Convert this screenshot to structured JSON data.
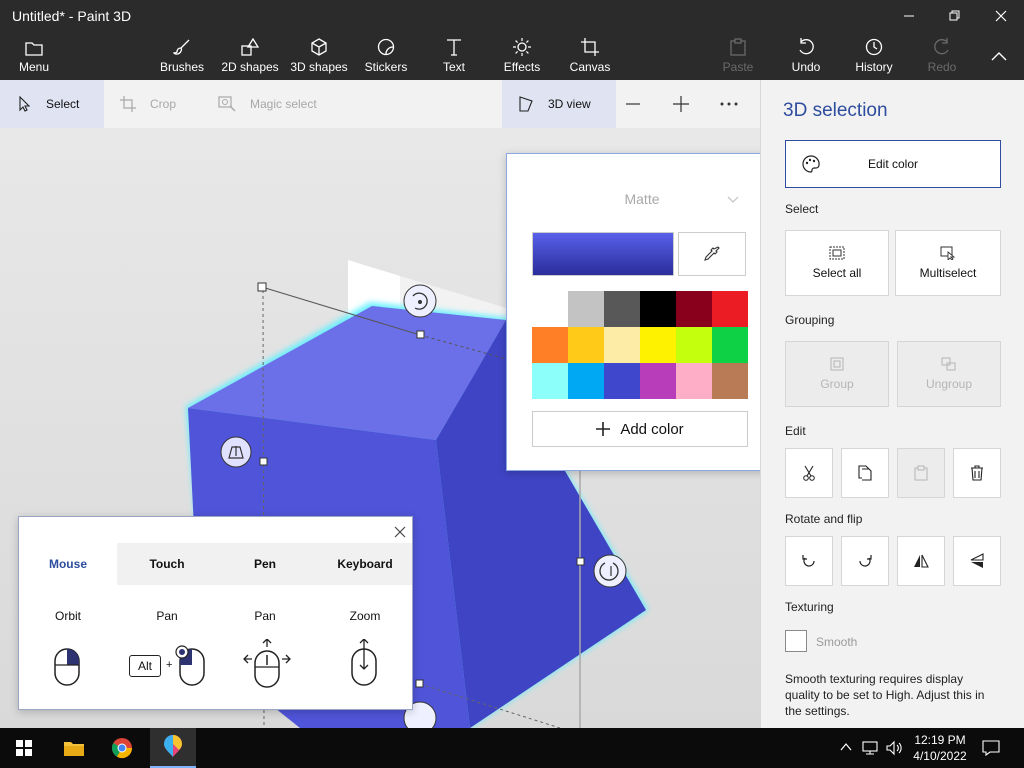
{
  "window": {
    "title": "Untitled* - Paint 3D"
  },
  "ribbon": {
    "menu": "Menu",
    "tools": [
      "Brushes",
      "2D shapes",
      "3D shapes",
      "Stickers",
      "Text",
      "Effects",
      "Canvas"
    ],
    "paste": "Paste",
    "undo": "Undo",
    "history": "History",
    "redo": "Redo"
  },
  "toolbar": {
    "select": "Select",
    "crop": "Crop",
    "magic_select": "Magic select",
    "view_3d": "3D view"
  },
  "color_popup": {
    "finish": "Matte",
    "selected_color": "#3b3fc8",
    "add_color": "Add color",
    "swatches": [
      "#ffffff",
      "#c3c3c3",
      "#585858",
      "#000000",
      "#88001b",
      "#ec1c24",
      "#ff7f27",
      "#ffca18",
      "#fdeca6",
      "#fff200",
      "#c4ff0e",
      "#0ed145",
      "#8cfffb",
      "#00a8f3",
      "#3f48cc",
      "#b83dba",
      "#ffaec8",
      "#b97a56"
    ]
  },
  "panel": {
    "title": "3D selection",
    "edit_color": "Edit color",
    "select_label": "Select",
    "select_all": "Select all",
    "multiselect": "Multiselect",
    "grouping_label": "Grouping",
    "group": "Group",
    "ungroup": "Ungroup",
    "edit_label": "Edit",
    "rotate_label": "Rotate and flip",
    "texturing_label": "Texturing",
    "smooth": "Smooth",
    "smooth_note": "Smooth texturing requires display quality to be set to High. Adjust this in the settings."
  },
  "help_popup": {
    "tabs": [
      "Mouse",
      "Touch",
      "Pen",
      "Keyboard"
    ],
    "actions": [
      "Orbit",
      "Pan",
      "Pan",
      "Zoom"
    ],
    "alt_key": "Alt",
    "plus": "+"
  },
  "taskbar": {
    "time": "12:19 PM",
    "date": "4/10/2022"
  }
}
